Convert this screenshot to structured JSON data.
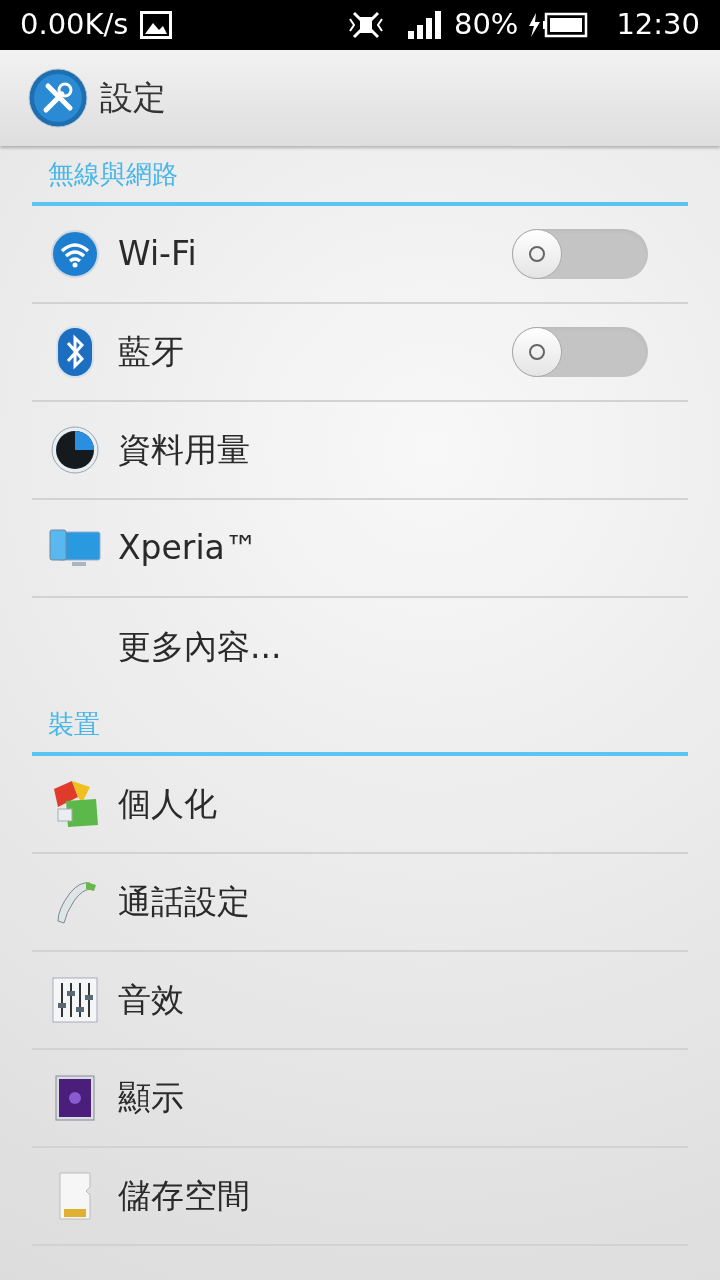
{
  "status_bar": {
    "speed": "0.00K/s",
    "battery": "80%",
    "time": "12:30"
  },
  "action_bar": {
    "title": "設定"
  },
  "sections": [
    {
      "title": "無線與網路",
      "items": [
        {
          "label": "Wi-Fi",
          "kind": "switch",
          "on": false
        },
        {
          "label": "藍牙",
          "kind": "switch",
          "on": false
        },
        {
          "label": "資料用量",
          "kind": "plain"
        },
        {
          "label": "Xperia™",
          "kind": "plain"
        },
        {
          "label": "更多內容...",
          "kind": "plain"
        }
      ]
    },
    {
      "title": "裝置",
      "items": [
        {
          "label": "個人化",
          "kind": "plain"
        },
        {
          "label": "通話設定",
          "kind": "plain"
        },
        {
          "label": "音效",
          "kind": "plain"
        },
        {
          "label": "顯示",
          "kind": "plain"
        },
        {
          "label": "儲存空間",
          "kind": "plain"
        }
      ]
    }
  ]
}
